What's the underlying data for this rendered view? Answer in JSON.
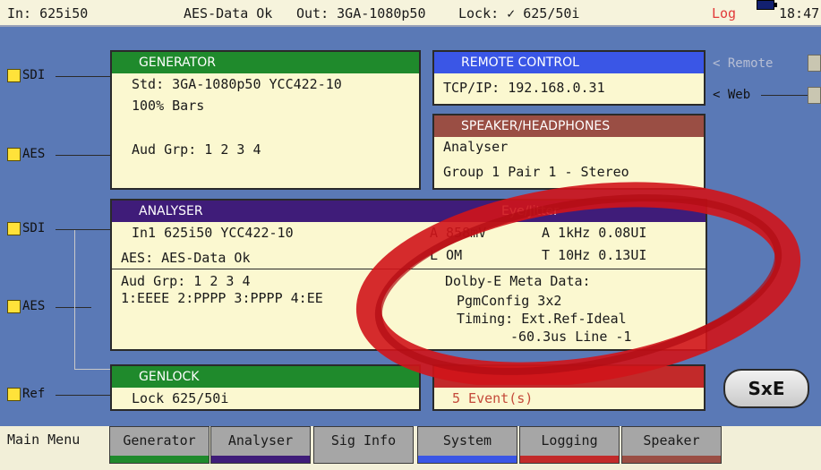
{
  "status": {
    "input": "In: 625i50",
    "aes": "AES-Data Ok",
    "output": "Out: 3GA-1080p50",
    "lock": "Lock: ✓ 625/50i",
    "log": "Log",
    "time": "18:47"
  },
  "ports": {
    "sdi_top": "SDI",
    "aes_top": "AES",
    "sdi_mid": "SDI",
    "aes_mid": "AES",
    "ref": "Ref"
  },
  "generator": {
    "title": "GENERATOR",
    "std": "Std: 3GA-1080p50 YCC422-10",
    "pattern": "100% Bars",
    "aud": "Aud Grp:  1 2 3 4"
  },
  "remote": {
    "title": "REMOTE CONTROL",
    "tcp": "TCP/IP: 192.168.0.31",
    "remote_label": "< Remote",
    "web_label": "< Web"
  },
  "speaker": {
    "title": "SPEAKER/HEADPHONES",
    "mode": "Analyser",
    "group": "Group 1 Pair 1 - Stereo"
  },
  "analyser": {
    "title": "ANALYSER",
    "eye": "Eye/Jitter",
    "in1": "In1  625i50 YCC422-10",
    "aes": "AES: AES-Data Ok",
    "a_val": "A 858mV",
    "a_freq": "A 1kHz  0.08UI",
    "t_val": "L  OM",
    "t_freq": "T 10Hz  0.13UI",
    "aud_grp": "Aud Grp:  1 2 3 4",
    "aud_status": "1:EEEE 2:PPPP 3:PPPP 4:EE",
    "dolby_title": "Dolby-E Meta Data:",
    "pgm": "PgmConfig   3x2",
    "timing": "Timing:  Ext.Ref-Ideal",
    "timing_value": "-60.3us  Line -1"
  },
  "genlock": {
    "title": "GENLOCK",
    "lock": "Lock   625/50i"
  },
  "logging": {
    "events": "5 Event(s)"
  },
  "sxe_label": "SxE",
  "menu": {
    "main": "Main Menu",
    "tabs": [
      "Generator",
      "Analyser",
      "Sig Info",
      "System",
      "Logging",
      "Speaker"
    ]
  },
  "colors": {
    "background": "#5a79b6",
    "generator": "#1f8a2c",
    "remote": "#3a56e6",
    "speaker": "#9a4e44",
    "analyser": "#3f1c79",
    "logging": "#c22a2a",
    "highlight": "#d0141a"
  }
}
